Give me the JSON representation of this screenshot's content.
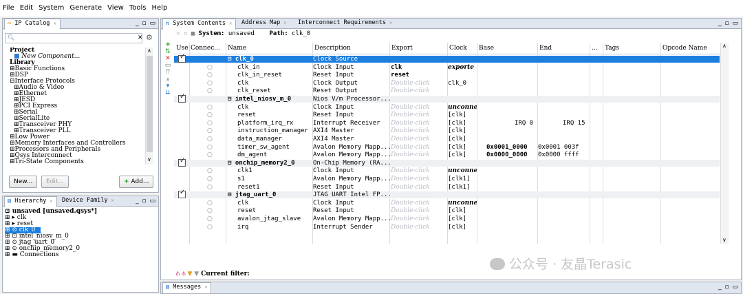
{
  "menu": [
    "File",
    "Edit",
    "System",
    "Generate",
    "View",
    "Tools",
    "Help"
  ],
  "ip_catalog": {
    "tab": "IP Catalog",
    "tree": [
      "Project",
      "  New Component...",
      "Library",
      "⊞Basic Functions",
      "⊞DSP",
      "⊟Interface Protocols",
      "  ⊞Audio & Video",
      "  ⊞Ethernet",
      "  ⊞JESD",
      "  ⊞PCI Express",
      "  ⊞Serial",
      "  ⊞SerialLite",
      "  ⊞Transceiver PHY",
      "  ⊞Transceiver PLL",
      "⊞Low Power",
      "⊞Memory Interfaces and Controllers",
      "⊞Processors and Peripherals",
      "⊞Qsys Interconnect",
      "⊞Tri-State Components"
    ],
    "buttons": {
      "new": "New...",
      "edit": "Edit...",
      "add": "Add..."
    }
  },
  "hierarchy": {
    "tabs": [
      "Hierarchy",
      "Device Family"
    ],
    "tree": [
      "unsaved [unsaved.qsys*]",
      "⊞ ▸ clk",
      "⊞ ▸ reset",
      "⊞ ⊙ clk_0",
      "⊞ ⊡ intel_niosv_m_0",
      "⊞ ⊙ jtag_uart_0",
      "⊞ ⊙ onchip_memory2_0",
      "⊞ ▬ Connections"
    ]
  },
  "main": {
    "tabs": [
      "System Contents",
      "Address Map",
      "Interconnect Requirements"
    ],
    "system_label": "System:",
    "system_value": "unsaved",
    "path_label": "Path:",
    "path_value": "clk_0",
    "columns": [
      "Use",
      "Connec...",
      "Name",
      "Description",
      "Export",
      "Clock",
      "Base",
      "End",
      "...",
      "Tags",
      "Opcode Name"
    ],
    "rows": [
      {
        "use": true,
        "name": "⊟ clk_0",
        "desc": "Clock Source",
        "export": "",
        "clock": "",
        "base": "",
        "end": "",
        "sel": true
      },
      {
        "name": "clk_in",
        "desc": "Clock Input",
        "export": "clk",
        "clock": "exporte",
        "base": "",
        "end": ""
      },
      {
        "name": "clk_in_reset",
        "desc": "Reset Input",
        "export": "reset",
        "clock": "",
        "base": "",
        "end": ""
      },
      {
        "name": "clk",
        "desc": "Clock Output",
        "export": "Double-click",
        "clock": "clk_0",
        "base": "",
        "end": ""
      },
      {
        "name": "clk_reset",
        "desc": "Reset Output",
        "export": "Double-click",
        "clock": "",
        "base": "",
        "end": ""
      },
      {
        "use": true,
        "name": "⊟ intel_niosv_m_0",
        "desc": "Nios V/m Processor...",
        "export": "",
        "clock": "",
        "base": "",
        "end": ""
      },
      {
        "name": "clk",
        "desc": "Clock Input",
        "export": "Double-click",
        "clock": "unconne",
        "base": "",
        "end": ""
      },
      {
        "name": "reset",
        "desc": "Reset Input",
        "export": "Double-click",
        "clock": "[clk]",
        "base": "",
        "end": ""
      },
      {
        "name": "platform_irq_rx",
        "desc": "Interrupt Receiver",
        "export": "Double-click",
        "clock": "[clk]",
        "base": "IRQ 0",
        "end": "IRQ 15"
      },
      {
        "name": "instruction_manager",
        "desc": "AXI4 Master",
        "export": "Double-click",
        "clock": "[clk]",
        "base": "",
        "end": ""
      },
      {
        "name": "data_manager",
        "desc": "AXI4 Master",
        "export": "Double-click",
        "clock": "[clk]",
        "base": "",
        "end": ""
      },
      {
        "name": "timer_sw_agent",
        "desc": "Avalon Memory Mapp...",
        "export": "Double-click",
        "clock": "[clk]",
        "base": "0x0001_0000",
        "end": "0x0001 003f"
      },
      {
        "name": "dm_agent",
        "desc": "Avalon Memory Mapp...",
        "export": "Double-click",
        "clock": "[clk]",
        "base": "0x0000_0000",
        "end": "0x0000 ffff"
      },
      {
        "use": true,
        "name": "⊟ onchip_memory2_0",
        "desc": "On-Chip Memory (RA...",
        "export": "",
        "clock": "",
        "base": "",
        "end": ""
      },
      {
        "name": "clk1",
        "desc": "Clock Input",
        "export": "Double-click",
        "clock": "unconne",
        "base": "",
        "end": ""
      },
      {
        "name": "s1",
        "desc": "Avalon Memory Mapp...",
        "export": "Double-click",
        "clock": "[clk1]",
        "base": "",
        "end": ""
      },
      {
        "name": "reset1",
        "desc": "Reset Input",
        "export": "Double-click",
        "clock": "[clk1]",
        "base": "",
        "end": ""
      },
      {
        "use": true,
        "name": "⊟ jtag_uart_0",
        "desc": "JTAG UART Intel FP...",
        "export": "",
        "clock": "",
        "base": "",
        "end": ""
      },
      {
        "name": "clk",
        "desc": "Clock Input",
        "export": "Double-click",
        "clock": "unconne",
        "base": "",
        "end": ""
      },
      {
        "name": "reset",
        "desc": "Reset Input",
        "export": "Double-click",
        "clock": "[clk]",
        "base": "",
        "end": ""
      },
      {
        "name": "avalon_jtag_slave",
        "desc": "Avalon Memory Mapp...",
        "export": "Double-click",
        "clock": "[clk]",
        "base": "",
        "end": ""
      },
      {
        "name": "irq",
        "desc": "Interrupt Sender",
        "export": "Double-click",
        "clock": "[clk]",
        "base": "",
        "end": ""
      }
    ],
    "filter_label": "Current filter:"
  },
  "messages": {
    "tab": "Messages"
  },
  "watermark": "公众号 · 友晶Terasic",
  "colors": {
    "selection": "#1c7fe0",
    "panel_border": "#a8b0bc",
    "tab_bg": "#dfe6f0",
    "ghost_text": "#b8bcc4"
  }
}
